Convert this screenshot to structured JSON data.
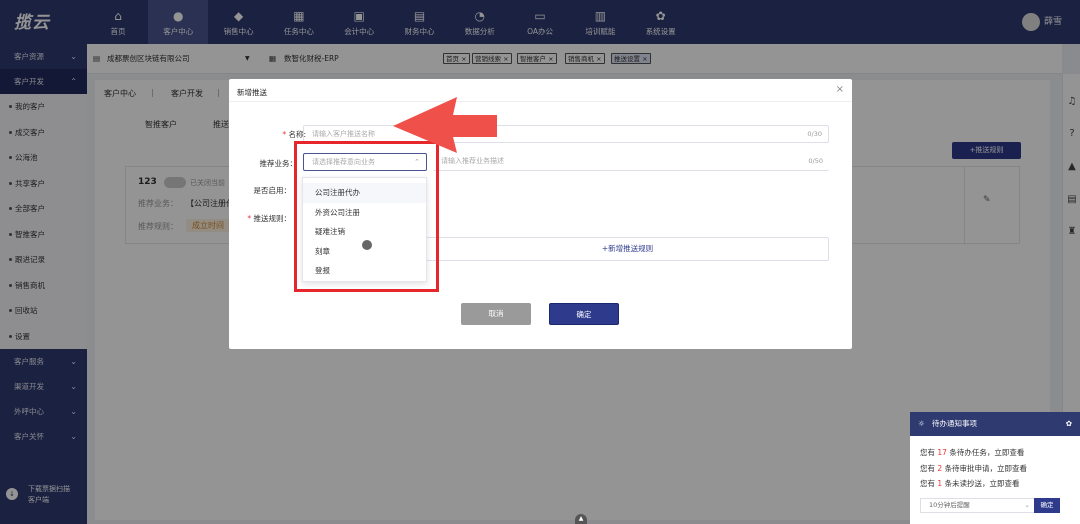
{
  "app": {
    "logo": "揽云"
  },
  "topnav": [
    {
      "label": "首页",
      "icon": "home-icon",
      "glyph": "⌂"
    },
    {
      "label": "客户中心",
      "icon": "user-icon",
      "glyph": "●"
    },
    {
      "label": "销售中心",
      "icon": "tag-icon",
      "glyph": "◆"
    },
    {
      "label": "任务中心",
      "icon": "calendar-icon",
      "glyph": "▦"
    },
    {
      "label": "会计中心",
      "icon": "calculator-icon",
      "glyph": "▣"
    },
    {
      "label": "财务中心",
      "icon": "finance-icon",
      "glyph": "▤"
    },
    {
      "label": "数据分析",
      "icon": "pie-chart-icon",
      "glyph": "◔"
    },
    {
      "label": "OA办公",
      "icon": "oa-icon",
      "glyph": "▭"
    },
    {
      "label": "培训赋能",
      "icon": "training-icon",
      "glyph": "▥"
    },
    {
      "label": "系统设置",
      "icon": "gear-icon",
      "glyph": "✿"
    }
  ],
  "user": {
    "name": "薛雪"
  },
  "sidebar": {
    "groups_top": [
      {
        "label": "客户资源"
      },
      {
        "label": "客户开发"
      }
    ],
    "items": [
      {
        "label": "我的客户"
      },
      {
        "label": "成交客户"
      },
      {
        "label": "公海池"
      },
      {
        "label": "共享客户"
      },
      {
        "label": "全部客户"
      },
      {
        "label": "智推客户"
      },
      {
        "label": "跟进记录"
      },
      {
        "label": "销售商机"
      },
      {
        "label": "回收站"
      },
      {
        "label": "设置"
      }
    ],
    "groups_bottom": [
      {
        "label": "客户服务"
      },
      {
        "label": "渠道开发"
      },
      {
        "label": "外呼中心"
      },
      {
        "label": "客户关怀"
      }
    ],
    "download_line1": "下载票据扫描",
    "download_line2": "客户端"
  },
  "subheader": {
    "company": "成都票创区块链有限公司",
    "product": "数智化财税-ERP",
    "tags": [
      "首页",
      "营销线索",
      "智推客户",
      "销售商机",
      "推送设置"
    ]
  },
  "background": {
    "breadcrumb": [
      "客户中心",
      "客户开发"
    ],
    "tabs": [
      "智推客户",
      "推送"
    ],
    "add_rule_button": "+推送规则",
    "record_id": "123",
    "record_status": "已关闭当前",
    "recommend_label": "推荐业务：",
    "recommend_value": "【公司注册代",
    "rule_label": "推荐规则：",
    "rule_tag": "成立时间"
  },
  "modal": {
    "title": "新增推送",
    "name_label": "名称:",
    "name_placeholder": "请输入客户推送名称",
    "name_count": "0/30",
    "business_label": "推荐业务：",
    "business_select_placeholder": "请选择推荐意向业务",
    "business_desc_placeholder": "请输入推荐业务描述",
    "business_count": "0/50",
    "enable_label": "是否启用：",
    "rule_label": "推送规则：",
    "add_rule": "+新增推送规则",
    "cancel": "取消",
    "confirm": "确定",
    "dropdown_options": [
      "公司注册代办",
      "外资公司注册",
      "疑难注销",
      "刻章",
      "登报"
    ]
  },
  "notification": {
    "title": "待办通知事项",
    "l1_pre": "您有",
    "l1_num": "17",
    "l1_post": "条待办任务，立即查看",
    "l2_pre": "您有",
    "l2_num": "2",
    "l2_post": "条待审批申请，立即查看",
    "l3_pre": "您有",
    "l3_num": "1",
    "l3_post": "条未读抄送，立即查看",
    "remind_select": "10分钟后提醒",
    "remind_button": "确定"
  },
  "colors": {
    "nav": "#2e3a70",
    "primary": "#2e3a8c",
    "highlight_box": "#e5262b",
    "arrow": "#f0504a"
  }
}
